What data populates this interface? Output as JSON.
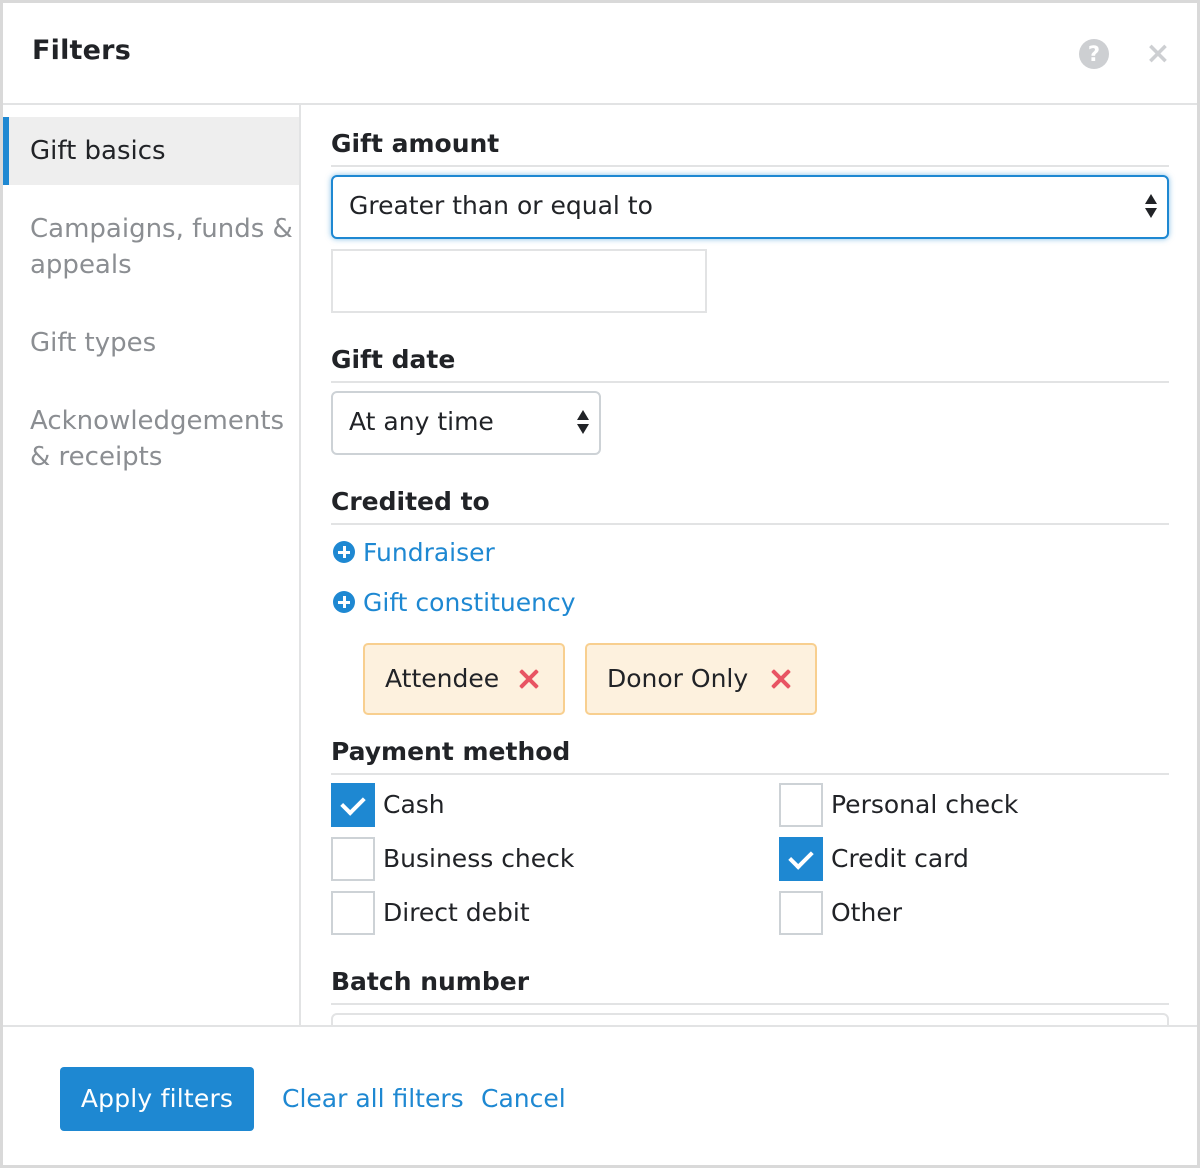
{
  "header": {
    "title": "Filters",
    "help_icon_glyph": "?",
    "close_icon_glyph": "×"
  },
  "sidebar": {
    "items": [
      {
        "label": "Gift basics"
      },
      {
        "label": "Campaigns, funds & appeals"
      },
      {
        "label": "Gift types"
      },
      {
        "label": "Acknowledgements & receipts"
      }
    ],
    "active": "Gift basics"
  },
  "sections": {
    "gift_amount": {
      "title": "Gift amount",
      "operator": "Greater than or equal to",
      "amount_value": ""
    },
    "gift_date": {
      "title": "Gift date",
      "range": "At any time"
    },
    "credited_to": {
      "title": "Credited to",
      "links": [
        {
          "label": "Fundraiser",
          "icon": "plus-circle-icon"
        },
        {
          "label": "Gift constituency",
          "icon": "plus-circle-icon"
        }
      ],
      "tags": [
        {
          "label": "Attendee",
          "icon": "remove-icon"
        },
        {
          "label": "Donor Only",
          "icon": "remove-icon"
        }
      ]
    },
    "payment_method": {
      "title": "Payment method",
      "options": [
        {
          "label": "Cash",
          "checked": true
        },
        {
          "label": "Personal check",
          "checked": false
        },
        {
          "label": "Business check",
          "checked": false
        },
        {
          "label": "Credit card",
          "checked": true
        },
        {
          "label": "Direct debit",
          "checked": false
        },
        {
          "label": "Other",
          "checked": false
        }
      ]
    },
    "batch_number": {
      "title": "Batch number"
    }
  },
  "footer": {
    "apply_label": "Apply filters",
    "clear_label": "Clear all filters",
    "cancel_label": "Cancel"
  },
  "colors": {
    "accent": "#1e88d2",
    "tag_background": "#fdf1de",
    "tag_border": "#f8cf8f",
    "remove": "#e85463"
  }
}
